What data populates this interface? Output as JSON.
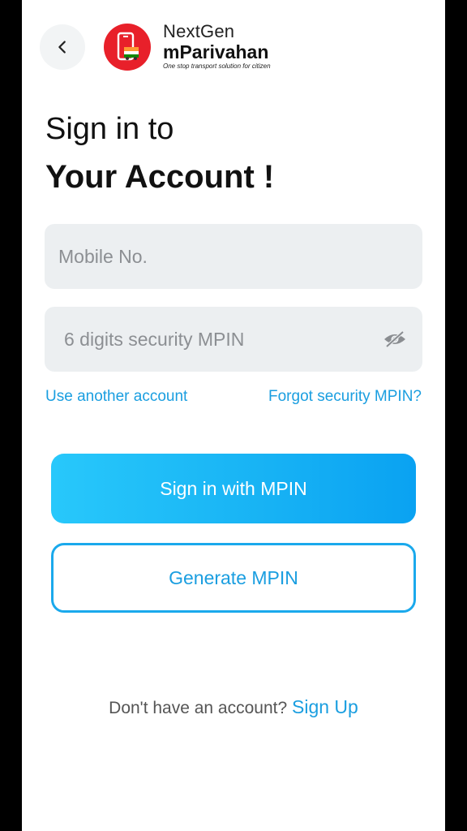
{
  "header": {
    "brand_top": "NextGen",
    "brand_name": "mParivahan",
    "brand_tagline": "One stop transport solution for citizen"
  },
  "title": {
    "line1": "Sign in to",
    "line2": "Your Account !"
  },
  "form": {
    "mobile_placeholder": "Mobile No.",
    "mpin_placeholder": "6 digits security MPIN"
  },
  "links": {
    "use_another": "Use another account",
    "forgot_mpin": "Forgot security MPIN?"
  },
  "buttons": {
    "sign_in": "Sign in with MPIN",
    "generate": "Generate MPIN"
  },
  "footer": {
    "prompt": "Don't have an account?",
    "signup": "Sign Up"
  },
  "colors": {
    "accent": "#1a9ee0",
    "logo_red": "#e8202a",
    "field_bg": "#eceff1"
  },
  "icons": {
    "back": "chevron-left-icon",
    "logo": "phone-car-logo-icon",
    "visibility": "eye-off-icon"
  }
}
